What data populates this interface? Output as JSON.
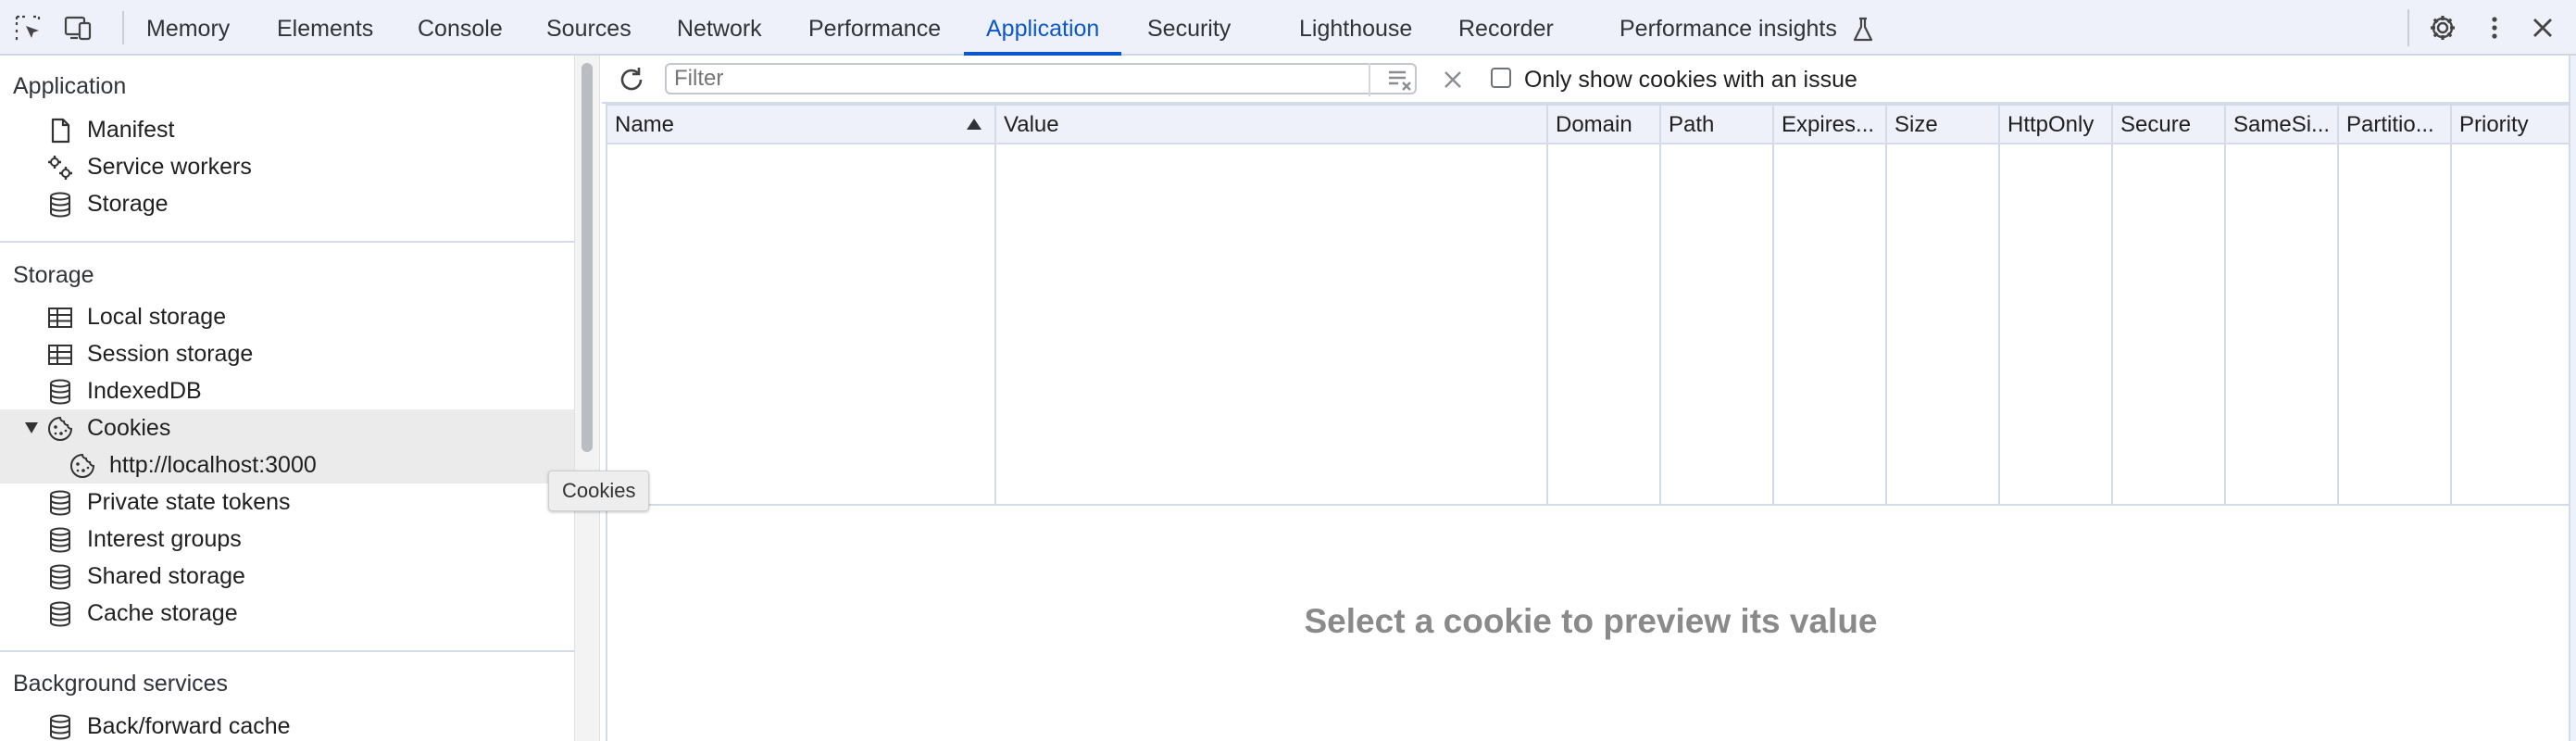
{
  "tabs": [
    "Memory",
    "Elements",
    "Console",
    "Sources",
    "Network",
    "Performance",
    "Application",
    "Security",
    "Lighthouse",
    "Recorder",
    "Performance insights"
  ],
  "active_tab": "Application",
  "sidebar": {
    "sections": [
      {
        "title": "Application",
        "items": [
          {
            "label": "Manifest",
            "icon": "document-icon"
          },
          {
            "label": "Service workers",
            "icon": "gears-icon"
          },
          {
            "label": "Storage",
            "icon": "database-icon"
          }
        ]
      },
      {
        "title": "Storage",
        "items": [
          {
            "label": "Local storage",
            "icon": "table-icon"
          },
          {
            "label": "Session storage",
            "icon": "table-icon"
          },
          {
            "label": "IndexedDB",
            "icon": "database-icon"
          },
          {
            "label": "Cookies",
            "icon": "cookie-icon",
            "expanded": true
          },
          {
            "label": "http://localhost:3000",
            "icon": "cookie-icon",
            "selected": true
          },
          {
            "label": "Private state tokens",
            "icon": "database-icon"
          },
          {
            "label": "Interest groups",
            "icon": "database-icon"
          },
          {
            "label": "Shared storage",
            "icon": "database-icon"
          },
          {
            "label": "Cache storage",
            "icon": "database-icon"
          }
        ]
      },
      {
        "title": "Background services",
        "items": [
          {
            "label": "Back/forward cache",
            "icon": "database-icon"
          }
        ]
      }
    ]
  },
  "tooltip": "Cookies",
  "filter": {
    "placeholder": "Filter",
    "value": ""
  },
  "issue_checkbox": {
    "label": "Only show cookies with an issue",
    "checked": false
  },
  "table": {
    "columns": [
      "Name",
      "Value",
      "Domain",
      "Path",
      "Expires...",
      "Size",
      "HttpOnly",
      "Secure",
      "SameSi...",
      "Partitio...",
      "Priority"
    ],
    "sorted_column": "Name",
    "sort_direction": "ascending",
    "rows": []
  },
  "preview_message": "Select a cookie to preview its value",
  "colors": {
    "accent": "#0b57d0",
    "toolbar_bg": "#eef1f9",
    "border": "#d3dae8",
    "selected_row": "#ebebeb"
  }
}
